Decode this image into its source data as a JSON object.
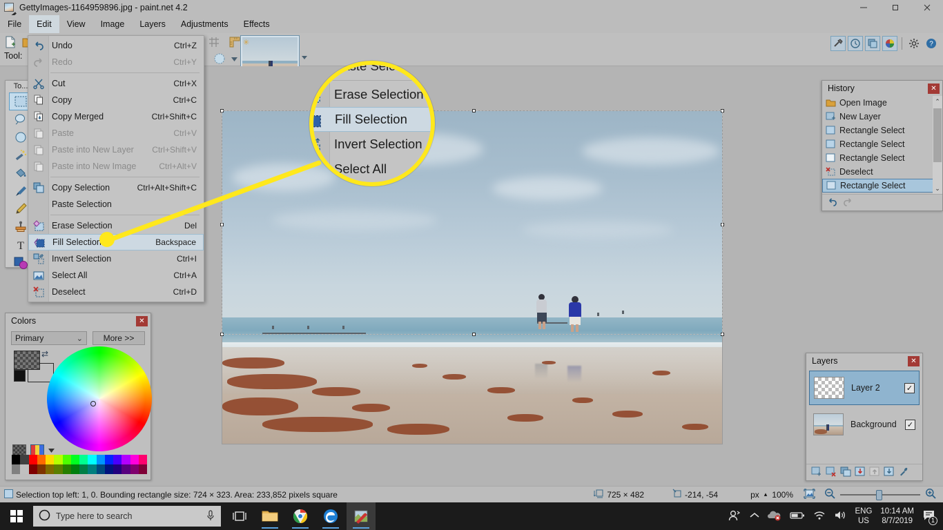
{
  "window": {
    "title": "GettyImages-1164959896.jpg - paint.net 4.2",
    "app_icon": "paintnet-icon",
    "minimize": "–",
    "maximize": "❐",
    "close": "✕"
  },
  "menubar": {
    "items": [
      {
        "label": "File",
        "active": false
      },
      {
        "label": "Edit",
        "active": true
      },
      {
        "label": "View",
        "active": false
      },
      {
        "label": "Image",
        "active": false
      },
      {
        "label": "Layers",
        "active": false
      },
      {
        "label": "Adjustments",
        "active": false
      },
      {
        "label": "Effects",
        "active": false
      }
    ]
  },
  "toolbar": {
    "tool_label": "Tool:",
    "panel_buttons": [
      {
        "name": "tools-toggle",
        "icon": "hammer-icon"
      },
      {
        "name": "history-toggle",
        "icon": "clock-history-icon"
      },
      {
        "name": "layers-toggle",
        "icon": "layers-icon"
      },
      {
        "name": "colors-toggle",
        "icon": "color-wheel-icon"
      }
    ],
    "settings_icon": "gear-icon",
    "help_icon": "question-help-icon"
  },
  "edit_menu": {
    "groups": [
      [
        {
          "label": "Undo",
          "shortcut": "Ctrl+Z",
          "icon": "undo-icon",
          "disabled": false,
          "highlight": false
        },
        {
          "label": "Redo",
          "shortcut": "Ctrl+Y",
          "icon": "redo-icon",
          "disabled": true,
          "highlight": false
        }
      ],
      [
        {
          "label": "Cut",
          "shortcut": "Ctrl+X",
          "icon": "scissors-icon",
          "disabled": false,
          "highlight": false
        },
        {
          "label": "Copy",
          "shortcut": "Ctrl+C",
          "icon": "copy-icon",
          "disabled": false,
          "highlight": false
        },
        {
          "label": "Copy Merged",
          "shortcut": "Ctrl+Shift+C",
          "icon": "copy-merged-icon",
          "disabled": false,
          "highlight": false
        },
        {
          "label": "Paste",
          "shortcut": "Ctrl+V",
          "icon": "paste-icon",
          "disabled": true,
          "highlight": false
        },
        {
          "label": "Paste into New Layer",
          "shortcut": "Ctrl+Shift+V",
          "icon": "paste-new-layer-icon",
          "disabled": true,
          "highlight": false
        },
        {
          "label": "Paste into New Image",
          "shortcut": "Ctrl+Alt+V",
          "icon": "paste-new-image-icon",
          "disabled": true,
          "highlight": false
        }
      ],
      [
        {
          "label": "Copy Selection",
          "shortcut": "Ctrl+Alt+Shift+C",
          "icon": "copy-selection-icon",
          "disabled": false,
          "highlight": false
        },
        {
          "label": "Paste Selection",
          "shortcut": "",
          "icon": "",
          "disabled": false,
          "highlight": false
        }
      ],
      [
        {
          "label": "Erase Selection",
          "shortcut": "Del",
          "icon": "erase-selection-icon",
          "disabled": false,
          "highlight": false
        },
        {
          "label": "Fill Selection",
          "shortcut": "Backspace",
          "icon": "fill-selection-icon",
          "disabled": false,
          "highlight": true
        },
        {
          "label": "Invert Selection",
          "shortcut": "Ctrl+I",
          "icon": "invert-selection-icon",
          "disabled": false,
          "highlight": false
        },
        {
          "label": "Select All",
          "shortcut": "Ctrl+A",
          "icon": "select-all-icon",
          "disabled": false,
          "highlight": false
        },
        {
          "label": "Deselect",
          "shortcut": "Ctrl+D",
          "icon": "deselect-icon",
          "disabled": false,
          "highlight": false
        }
      ]
    ]
  },
  "magnifier": {
    "callout_color": "#ffe81c",
    "items": [
      {
        "label": "Paste Selection",
        "icon": "",
        "highlight": false,
        "separator_after": true
      },
      {
        "label": "Erase Selection",
        "icon": "erase-selection-icon",
        "highlight": false,
        "separator_after": false
      },
      {
        "label": "Fill Selection",
        "icon": "fill-selection-icon",
        "highlight": true,
        "separator_after": false
      },
      {
        "label": "Invert Selection",
        "icon": "invert-selection-icon",
        "highlight": false,
        "separator_after": false
      },
      {
        "label": "Select All",
        "icon": "select-all-icon",
        "highlight": false,
        "separator_after": false
      }
    ]
  },
  "tools_panel": {
    "title": "To...",
    "tools": [
      {
        "name": "rectangle-select-tool",
        "icon": "rectangle-select-icon",
        "selected": true
      },
      {
        "name": "lasso-select-tool",
        "icon": "lasso-icon",
        "selected": false
      },
      {
        "name": "ellipse-select-tool",
        "icon": "ellipse-icon",
        "selected": false
      },
      {
        "name": "magic-wand-tool",
        "icon": "magic-wand-icon",
        "selected": false
      },
      {
        "name": "paint-bucket-tool",
        "icon": "paint-bucket-icon",
        "selected": false
      },
      {
        "name": "paintbrush-tool",
        "icon": "paintbrush-icon",
        "selected": false
      },
      {
        "name": "pencil-tool",
        "icon": "pencil-icon",
        "selected": false
      },
      {
        "name": "clone-stamp-tool",
        "icon": "clone-stamp-icon",
        "selected": false
      },
      {
        "name": "text-tool",
        "icon": "text-t-icon",
        "selected": false
      },
      {
        "name": "shapes-tool",
        "icon": "shapes-icon",
        "selected": false
      }
    ]
  },
  "colors_panel": {
    "title": "Colors",
    "close": "✕",
    "channel_select": "Primary",
    "channel_caret": "⌄",
    "more_button": "More >>",
    "primary_swatch": "transparent-checker",
    "secondary_swatch": "#bfbfbf",
    "palette_row1": [
      "#000000",
      "#404040",
      "#ff0000",
      "#ff6a00",
      "#ffd800",
      "#b6ff00",
      "#4cff00",
      "#00ff21",
      "#00ff90",
      "#00ffff",
      "#0094ff",
      "#0026ff",
      "#4800ff",
      "#b200ff",
      "#ff00dc",
      "#ff006e"
    ],
    "palette_row2": [
      "#808080",
      "#c0c0c0",
      "#7f0000",
      "#7f3300",
      "#7f6a00",
      "#5b7f00",
      "#267f00",
      "#007f0e",
      "#007f46",
      "#007f7f",
      "#004a7f",
      "#00137f",
      "#21007f",
      "#57007f",
      "#7f006e",
      "#7f0037"
    ]
  },
  "history_panel": {
    "title": "History",
    "close": "✕",
    "items": [
      {
        "label": "Open Image",
        "icon": "folder-icon",
        "selected": false
      },
      {
        "label": "New Layer",
        "icon": "new-layer-icon",
        "selected": false
      },
      {
        "label": "Rectangle Select",
        "icon": "rectangle-select-icon",
        "selected": false
      },
      {
        "label": "Rectangle Select",
        "icon": "rectangle-select-icon",
        "selected": false
      },
      {
        "label": "Rectangle Select",
        "icon": "rectangle-select-icon",
        "selected": false
      },
      {
        "label": "Deselect",
        "icon": "deselect-icon",
        "selected": false
      },
      {
        "label": "Rectangle Select",
        "icon": "rectangle-select-icon",
        "selected": true
      }
    ],
    "scroll_up": "⌃",
    "scroll_down": "⌄",
    "footer_buttons": [
      {
        "name": "history-undo-button",
        "icon": "undo-icon"
      },
      {
        "name": "history-redo-button",
        "icon": "redo-icon"
      }
    ]
  },
  "layers_panel": {
    "title": "Layers",
    "close": "✕",
    "layers": [
      {
        "name": "Layer 2",
        "thumb": "transparent-checker",
        "visible": true,
        "checkmark": "✓",
        "selected": true
      },
      {
        "name": "Background",
        "thumb": "beach-photo",
        "visible": true,
        "checkmark": "✓",
        "selected": false
      }
    ],
    "footer_buttons": [
      {
        "name": "add-layer-button",
        "icon": "add-layer-icon"
      },
      {
        "name": "delete-layer-button",
        "icon": "delete-layer-icon"
      },
      {
        "name": "duplicate-layer-button",
        "icon": "duplicate-layer-icon"
      },
      {
        "name": "merge-layer-down-button",
        "icon": "merge-down-icon"
      },
      {
        "name": "move-layer-up-button",
        "icon": "move-up-icon"
      },
      {
        "name": "move-layer-down-button",
        "icon": "move-down-icon"
      },
      {
        "name": "layer-properties-button",
        "icon": "wrench-icon"
      }
    ]
  },
  "statusbar": {
    "selection_info": "Selection top left: 1, 0. Bounding rectangle size: 724 × 323. Area: 233,852 pixels square",
    "image_size": "725 × 482",
    "cursor_position": "-214, -54",
    "units": "px",
    "units_caret": "▴",
    "zoom_level": "100%",
    "icons": {
      "selection": "selection-icon",
      "image_size": "image-size-icon",
      "cursor": "cursor-position-icon",
      "fit": "fit-to-window-icon",
      "zoom_out": "zoom-out-icon",
      "zoom_in": "zoom-in-icon"
    }
  },
  "canvas": {
    "selection_marquee": true,
    "image_description": "beach-photo-two-people-walking"
  },
  "taskbar": {
    "start_icon": "windows-start-icon",
    "search_placeholder": "Type here to search",
    "search_icon": "cortana-circle-icon",
    "mic_icon": "microphone-icon",
    "apps": [
      {
        "name": "task-view-button",
        "icon": "task-view-icon",
        "active": false,
        "running": false
      },
      {
        "name": "file-explorer-button",
        "icon": "file-explorer-icon",
        "active": false,
        "running": true
      },
      {
        "name": "chrome-button",
        "icon": "chrome-icon",
        "active": false,
        "running": true
      },
      {
        "name": "edge-button",
        "icon": "edge-icon",
        "active": false,
        "running": true
      },
      {
        "name": "paintnet-button",
        "icon": "paintnet-icon",
        "active": true,
        "running": true
      }
    ],
    "tray": {
      "people_icon": "people-icon",
      "chevron_icon": "show-hidden-icons-icon",
      "onedrive_icon": "onedrive-error-icon",
      "battery_icon": "battery-icon",
      "wifi_icon": "wifi-icon",
      "volume_icon": "volume-icon",
      "lang_line1": "ENG",
      "lang_line2": "US",
      "time": "10:14 AM",
      "date": "8/7/2019",
      "notification_icon": "notification-icon",
      "notification_count": "1"
    }
  }
}
